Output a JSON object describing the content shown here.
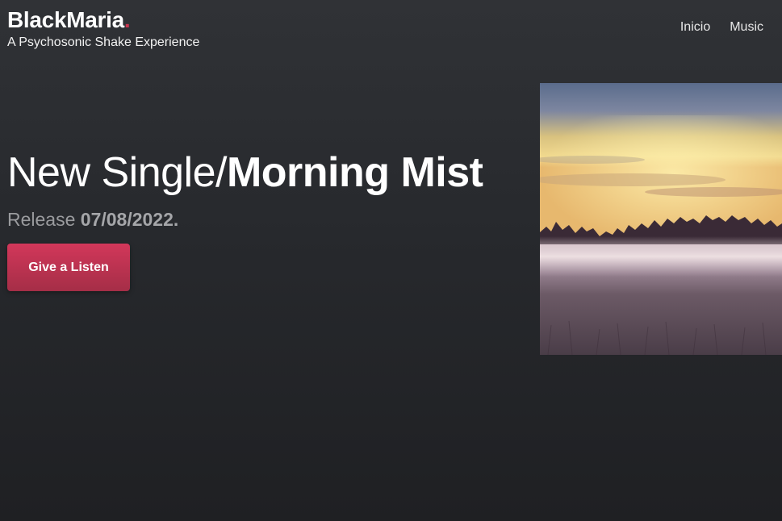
{
  "brand": {
    "name": "BlackMaria",
    "dot": ".",
    "tagline": "A Psychosonic Shake Experience",
    "accent_color": "#c9344f"
  },
  "nav": {
    "items": [
      {
        "label": "Inicio"
      },
      {
        "label": "Music"
      }
    ]
  },
  "hero": {
    "title_light": "New Single/",
    "title_bold": "Morning Mist",
    "release_label": "Release ",
    "release_date": "07/08/2022.",
    "cta_label": "Give a Listen",
    "cta_color": "#c9344f"
  },
  "artwork": {
    "description_icon": "misty-field-image"
  }
}
